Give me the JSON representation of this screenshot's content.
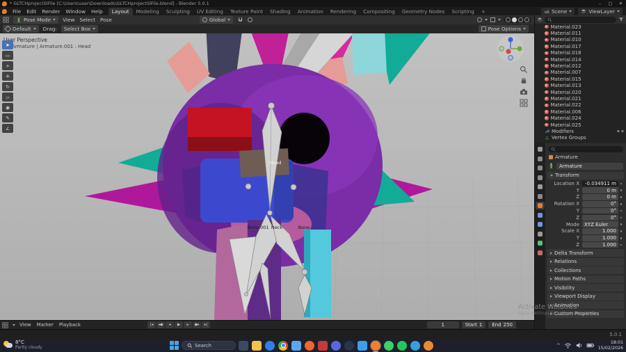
{
  "window": {
    "title": "* GLTCHprojectSlFile [C:\\Users\\user\\Downloads\\GLTCHprojectSlFile.blend] - Blender 5.0.1",
    "min": "–",
    "max": "▢",
    "close": "✕"
  },
  "menubar": {
    "menus": [
      "File",
      "Edit",
      "Render",
      "Window",
      "Help"
    ],
    "workspaces": [
      {
        "label": "Layout",
        "active": true
      },
      {
        "label": "Modeling"
      },
      {
        "label": "Sculpting"
      },
      {
        "label": "UV Editing"
      },
      {
        "label": "Texture Paint"
      },
      {
        "label": "Shading"
      },
      {
        "label": "Animation"
      },
      {
        "label": "Rendering"
      },
      {
        "label": "Compositing"
      },
      {
        "label": "Geometry Nodes"
      },
      {
        "label": "Scripting"
      }
    ],
    "add_tab": "+",
    "scene_label": "Scene",
    "viewlayer_label": "ViewLayer"
  },
  "viewport": {
    "mode": "Pose Mode",
    "menus": [
      "View",
      "Select",
      "Pose"
    ],
    "orientation": "Global",
    "tool_value": "Default",
    "drag_label": "Drag:",
    "drag_value": "Select Box",
    "pose_options": "Pose Options",
    "overlay_perspective": "User Perspective",
    "overlay_context": "(1) Armature | Armature.001 : Head",
    "tools": [
      {
        "glyph": "➤",
        "name": "tweak-select",
        "active": true
      },
      {
        "glyph": "▭",
        "name": "select-box"
      },
      {
        "glyph": "+",
        "name": "cursor"
      },
      {
        "glyph": "✛",
        "name": "move"
      },
      {
        "glyph": "↻",
        "name": "rotate"
      },
      {
        "glyph": "▱",
        "name": "scale"
      },
      {
        "glyph": "◉",
        "name": "transform"
      },
      {
        "glyph": "✎",
        "name": "annotate"
      },
      {
        "glyph": "∠",
        "name": "measure"
      }
    ],
    "bones": {
      "head": "Head",
      "bone001": "Bone.001",
      "neck": "Neck",
      "bone": "Bone"
    }
  },
  "outliner": {
    "materials": [
      "Material.023",
      "Material.011",
      "Material.010",
      "Material.017",
      "Material.018",
      "Material.014",
      "Material.012",
      "Material.007",
      "Material.015",
      "Material.013",
      "Material.020",
      "Material.021",
      "Material.022",
      "Material.006",
      "Material.024",
      "Material.025"
    ],
    "modifiers_label": "Modifiers",
    "vertex_groups_label": "Vertex Groups"
  },
  "properties": {
    "breadcrumb": "Armature",
    "object_name": "Armature",
    "transform_label": "Transform",
    "rows": [
      {
        "label": "Location X",
        "value": "-0.034911 m",
        "class": "editing"
      },
      {
        "label": "Y",
        "value": "0 m"
      },
      {
        "label": "Z",
        "value": "0 m"
      },
      {
        "label": "Rotation X",
        "value": "0°"
      },
      {
        "label": "Y",
        "value": "0°"
      },
      {
        "label": "Z",
        "value": "0°"
      },
      {
        "label": "Mode",
        "value": "XYZ Euler",
        "class": "dropdown"
      },
      {
        "label": "Scale X",
        "value": "1.000"
      },
      {
        "label": "Y",
        "value": "1.000"
      },
      {
        "label": "Z",
        "value": "1.000"
      }
    ],
    "sections": [
      "Delta Transform",
      "Relations",
      "Collections",
      "Motion Paths",
      "Visibility",
      "Viewport Display",
      "Animation",
      "Custom Properties"
    ],
    "tabs": [
      {
        "name": "tool",
        "color": "#9a9a9a"
      },
      {
        "name": "render",
        "color": "#8a8a8a"
      },
      {
        "name": "output",
        "color": "#8a8a8a"
      },
      {
        "name": "view-layer",
        "color": "#8a8a8a"
      },
      {
        "name": "scene",
        "color": "#9a9a9a"
      },
      {
        "name": "world",
        "color": "#8a8a8a"
      },
      {
        "name": "object",
        "color": "#e87d2c",
        "active": true
      },
      {
        "name": "modifiers",
        "color": "#6f96dc"
      },
      {
        "name": "physics",
        "color": "#6f96dc"
      },
      {
        "name": "constraints",
        "color": "#9a9a9a"
      },
      {
        "name": "object-data",
        "color": "#58c470"
      },
      {
        "name": "material",
        "color": "#c46a6a"
      }
    ]
  },
  "timeline": {
    "menus": [
      "View",
      "Marker",
      "Playback"
    ],
    "transport": [
      "|◂",
      "◂◆",
      "◂",
      "▶",
      "▸",
      "◆▸",
      "▸|"
    ],
    "current_frame": "1",
    "start_label": "Start",
    "start_value": "1",
    "end_label": "End",
    "end_value": "250"
  },
  "statusbar": {
    "version": "5.0.1"
  },
  "taskbar": {
    "weather_temp": "8°C",
    "weather_desc": "Partly cloudy",
    "search": "Search",
    "apps": [
      {
        "name": "task-view",
        "color": "#3b4a63"
      },
      {
        "name": "file-explorer",
        "color": "#f2c14e"
      },
      {
        "name": "edge",
        "color": "#2f7fe8",
        "round": true
      },
      {
        "name": "chrome",
        "chrome": true,
        "round": true
      },
      {
        "name": "store",
        "color": "#59a8f0"
      },
      {
        "name": "firefox",
        "color": "#f0662e",
        "round": true
      },
      {
        "name": "mail",
        "color": "#c23b3b"
      },
      {
        "name": "discord",
        "color": "#5a66e0",
        "round": true
      },
      {
        "name": "steam",
        "color": "#28354d",
        "round": true
      },
      {
        "name": "vscode",
        "color": "#3aa0e8"
      },
      {
        "name": "blender",
        "color": "#f08030",
        "round": true,
        "active": true
      },
      {
        "name": "whatsapp",
        "color": "#3ed06a",
        "round": true
      },
      {
        "name": "spotify",
        "color": "#25c75a",
        "round": true
      },
      {
        "name": "telegram",
        "color": "#35a0dc",
        "round": true
      },
      {
        "name": "vlc",
        "color": "#e88c2e",
        "round": true
      }
    ],
    "tray_chevron": "^",
    "tray_time": "18:01",
    "tray_date": "15/02/2026"
  },
  "watermark": {
    "line1": "Activate Windows",
    "line2": "Go to Settings to activate Windows."
  }
}
